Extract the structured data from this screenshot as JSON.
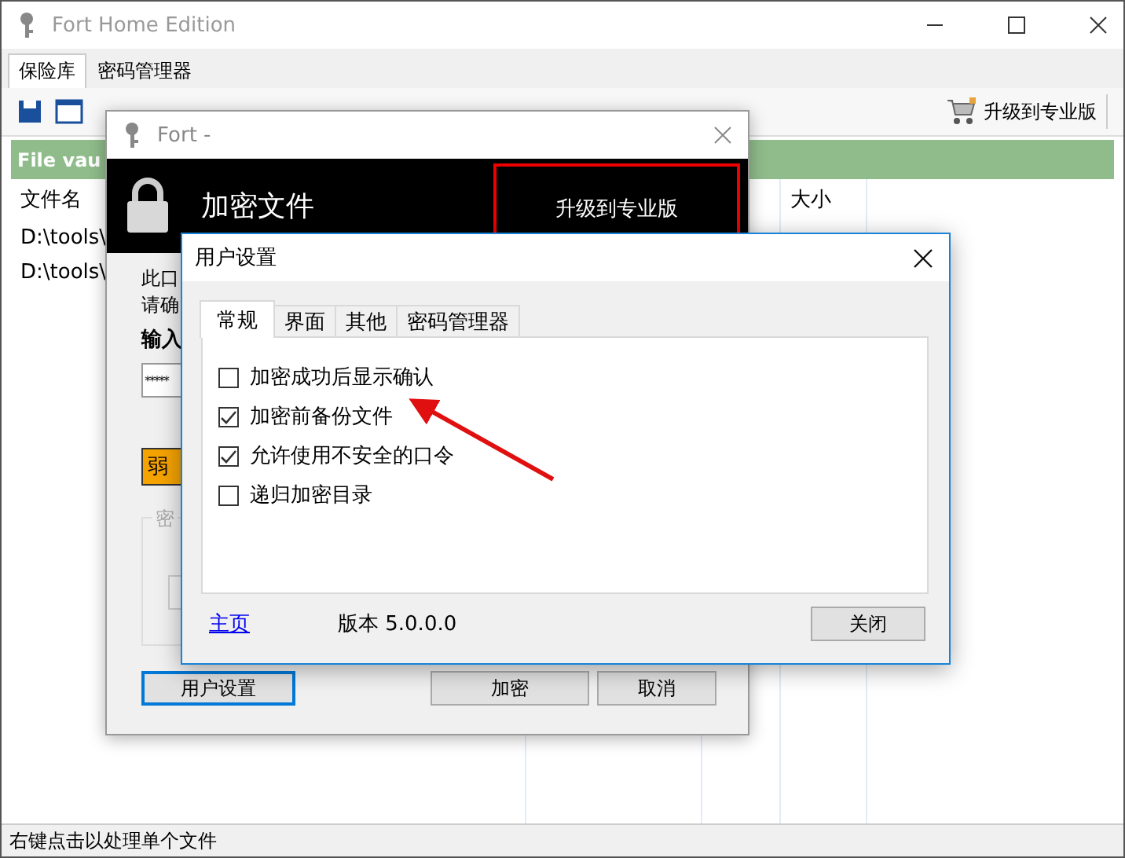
{
  "main_window": {
    "title": "Fort Home Edition",
    "tabs": [
      {
        "label": "保险库",
        "selected": true
      },
      {
        "label": "密码管理器",
        "selected": false
      }
    ],
    "upgrade_button": "升级到专业版",
    "vault_title": "File vau",
    "columns": [
      "文件名",
      "大小"
    ],
    "rows": [
      {
        "name": "D:\\tools\\"
      },
      {
        "name": "D:\\tools\\"
      }
    ],
    "status_bar": "右键点击以处理单个文件"
  },
  "encrypt_window": {
    "title": "Fort -",
    "header": "加密文件",
    "upgrade_button": "升级到专业版",
    "lines": [
      "此口",
      "请确"
    ],
    "password_label": "输入",
    "password_value": "*****",
    "strength": "弱",
    "group_legend": "密",
    "buttons": [
      {
        "label": "用户设置",
        "focused": true
      },
      {
        "label": "加密",
        "focused": false
      },
      {
        "label": "取消",
        "focused": false
      }
    ]
  },
  "settings_dialog": {
    "title": "用户设置",
    "tabs": [
      {
        "label": "常规",
        "selected": true
      },
      {
        "label": "界面",
        "selected": false
      },
      {
        "label": "其他",
        "selected": false
      },
      {
        "label": "密码管理器",
        "selected": false
      }
    ],
    "options": [
      {
        "label": "加密成功后显示确认",
        "checked": false
      },
      {
        "label": "加密前备份文件",
        "checked": true
      },
      {
        "label": "允许使用不安全的口令",
        "checked": true
      },
      {
        "label": "递归加密目录",
        "checked": false
      }
    ],
    "home_link": "主页",
    "version": "版本 5.0.0.0",
    "close_button": "关闭"
  }
}
